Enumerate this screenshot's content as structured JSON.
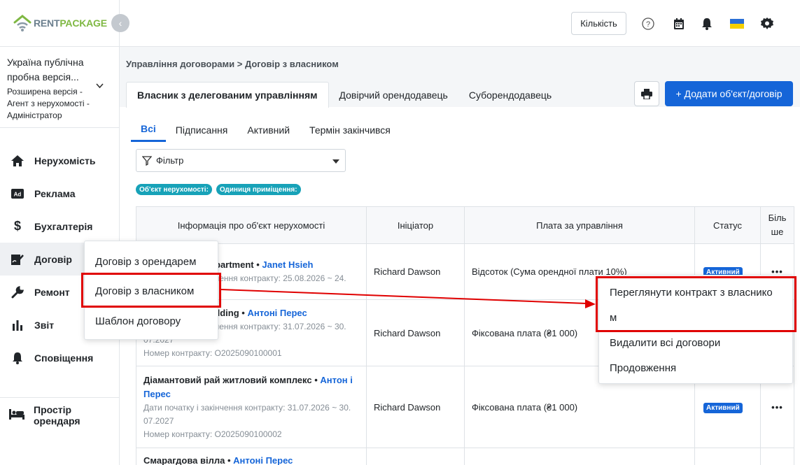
{
  "brand": {
    "name_part1": "RENT",
    "name_part2": "PACKAGE"
  },
  "org": {
    "name": "Україна публічна пробна версія...",
    "role": "Розширена версія - Агент з нерухомості - Адміністратор"
  },
  "sidebar": {
    "items": [
      {
        "label": "Нерухомість",
        "icon": "home-icon"
      },
      {
        "label": "Реклама",
        "icon": "ad-icon"
      },
      {
        "label": "Бухгалтерія",
        "icon": "dollar-icon"
      },
      {
        "label": "Договір",
        "icon": "contract-icon"
      },
      {
        "label": "Ремонт",
        "icon": "wrench-icon"
      },
      {
        "label": "Звіт",
        "icon": "bar-chart-icon"
      },
      {
        "label": "Сповіщення",
        "icon": "bell-icon"
      }
    ],
    "tenant_space": "Простір орендаря"
  },
  "topbar": {
    "quantity_label": "Кількість"
  },
  "breadcrumb": "Управління договорами > Договір з власником",
  "tabs": [
    "Власник з делегованим управлінням",
    "Довірчий орендодавець",
    "Суборендодавець"
  ],
  "add_button": "+ Додати об'єкт/договір",
  "subtabs": [
    "Всі",
    "Підписання",
    "Активний",
    "Термін закінчився"
  ],
  "filter": {
    "label": "Фільтр"
  },
  "chips": [
    "Об'єкт нерухомості:",
    "Одиниця приміщення:"
  ],
  "table": {
    "headers": [
      "Інформація про об'єкт нерухомості",
      "Ініціатор",
      "Плата за управління",
      "Статус",
      "Біль ше"
    ],
    "rows": [
      {
        "title": "partment",
        "sep": " • ",
        "agent": "Janet Hsieh",
        "dates": "чення контракту: 25.08.2026 ~ 24.",
        "number": "",
        "initiator": "Richard Dawson",
        "fee": "Відсоток (Сума орендної плати 10%)",
        "status": "Активний"
      },
      {
        "title": "ilding",
        "sep": " • ",
        "agent": "Антоні Перес",
        "dates": "чення контракту: 31.07.2026 ~ 30.",
        "dates2": "07.2027",
        "number": "Номер контракту: O2025090100001",
        "initiator": "Richard Dawson",
        "fee": "Фіксована плата (₴1 000)",
        "status": ""
      },
      {
        "title": "Діамантовий рай житловий комплекс",
        "sep": " • ",
        "agent": "Антон і Перес",
        "dates": "Дати початку і закінчення контракту: 31.07.2026 ~ 30.",
        "dates2": "07.2027",
        "number": "Номер контракту: O2025090100002",
        "initiator": "Richard Dawson",
        "fee": "Фіксована плата (₴1 000)",
        "status": "Активний"
      },
      {
        "title": "Смарагдова вілла",
        "sep": " • ",
        "agent": "Антоні Перес"
      }
    ],
    "more_glyph": "•••"
  },
  "contract_menu": [
    "Договір з орендарем",
    "Договір з власником",
    "Шаблон договору"
  ],
  "row_menu": [
    "Переглянути контракт з власнико",
    "м",
    "Видалити всі договори",
    "Продовження"
  ],
  "colors": {
    "accent": "#1565d8",
    "highlight": "#e00000",
    "chip": "#17a2b8"
  }
}
